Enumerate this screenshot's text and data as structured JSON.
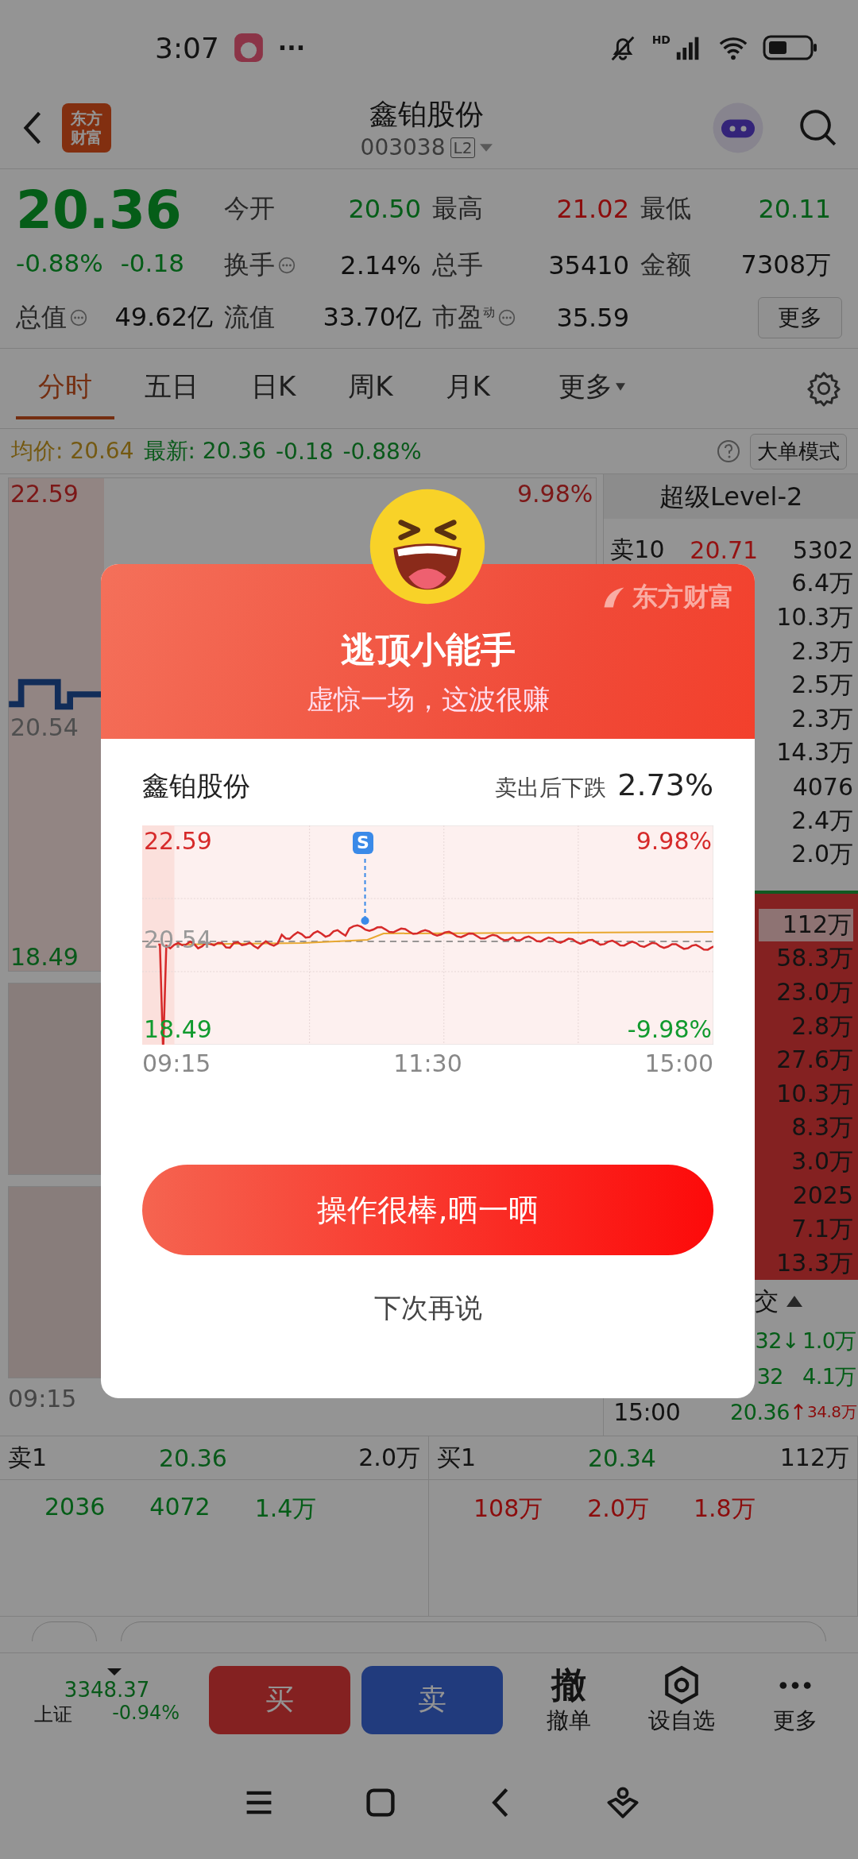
{
  "status_bar": {
    "time": "3:07",
    "more": "···",
    "network": "HD"
  },
  "header": {
    "logo": [
      "东方",
      "财富"
    ],
    "title": "鑫铂股份",
    "code": "003038",
    "badge": "L2"
  },
  "quote": {
    "price": "20.36",
    "change_pct": "-0.88%",
    "change": "-0.18",
    "kind": "down",
    "stats": [
      {
        "label": "今开",
        "value": "20.50",
        "kind": "down",
        "info": false
      },
      {
        "label": "最高",
        "value": "21.02",
        "kind": "up",
        "info": false
      },
      {
        "label": "最低",
        "value": "20.11",
        "kind": "down",
        "info": false
      },
      {
        "label": "换手",
        "value": "2.14%",
        "kind": "flat",
        "info": true
      },
      {
        "label": "总手",
        "value": "35410",
        "kind": "flat",
        "info": false
      },
      {
        "label": "金额",
        "value": "7308万",
        "kind": "flat",
        "info": false
      },
      {
        "label": "总值",
        "value": "49.62亿",
        "kind": "flat",
        "info": true
      },
      {
        "label": "流值",
        "value": "33.70亿",
        "kind": "flat",
        "info": false
      },
      {
        "label": "市盈",
        "sup": "动",
        "value": "35.59",
        "kind": "flat",
        "info": true
      }
    ],
    "more_button": "更多"
  },
  "tabs": [
    {
      "label": "分时",
      "selected": true,
      "kind": "tab"
    },
    {
      "label": "五日",
      "selected": false,
      "kind": "tab"
    },
    {
      "label": "日K",
      "selected": false,
      "kind": "tab"
    },
    {
      "label": "周K",
      "selected": false,
      "kind": "tab"
    },
    {
      "label": "月K",
      "selected": false,
      "kind": "tab"
    },
    {
      "label": "更多",
      "selected": false,
      "kind": "dropdown"
    }
  ],
  "info_line": {
    "avg_label": "均价:",
    "avg": "20.64",
    "latest_label": "最新:",
    "latest": "20.36",
    "change": "-0.18",
    "change_pct": "-0.88%",
    "mode_button": "大单模式"
  },
  "main_chart": {
    "top_price": "22.59",
    "top_pct": "9.98%",
    "mid_price": "20.54",
    "bottom_price": "18.49",
    "start_time": "09:15"
  },
  "order_book": {
    "title": "超级Level-2",
    "sell": [
      {
        "label": "卖10",
        "price": "20.71",
        "qty": "5302"
      },
      {
        "qty": "6.4万"
      },
      {
        "qty": "10.3万"
      },
      {
        "qty": "2.3万"
      },
      {
        "qty": "2.5万"
      },
      {
        "qty": "2.3万"
      },
      {
        "qty": "14.3万"
      },
      {
        "qty": "4076"
      },
      {
        "qty": "2.4万"
      },
      {
        "qty": "2.0万"
      }
    ],
    "buy": [
      {
        "qty": "112万",
        "highlighted": true
      },
      {
        "qty": "58.3万",
        "highlighted": false
      },
      {
        "qty": "23.0万",
        "highlighted": false
      },
      {
        "qty": "2.8万",
        "highlighted": false
      },
      {
        "qty": "27.6万",
        "highlighted": false
      },
      {
        "qty": "10.3万",
        "highlighted": false
      },
      {
        "qty": "8.3万",
        "highlighted": false
      },
      {
        "qty": "3.0万",
        "highlighted": false
      },
      {
        "qty": "2025",
        "highlighted": false
      },
      {
        "qty": "7.1万",
        "highlighted": false
      },
      {
        "qty": "13.3万",
        "highlighted": false
      }
    ],
    "trades_title": "交",
    "trades": [
      {
        "price": "32",
        "arrow": "↓",
        "volume": "1.0万",
        "kind": "down"
      },
      {
        "price": "32",
        "volume": "4.1万",
        "kind": "down"
      },
      {
        "time": "15:00",
        "price": "20.36",
        "arrow": "↑",
        "volume": "34.8万",
        "kind": "mixed"
      }
    ]
  },
  "level1": {
    "sell": {
      "label": "卖1",
      "price": "20.36",
      "qty": "2.0万",
      "details": [
        "2036",
        "4072",
        "1.4万"
      ]
    },
    "buy": {
      "label": "买1",
      "price": "20.34",
      "qty": "112万",
      "details": [
        "108万",
        "2.0万",
        "1.8万"
      ]
    }
  },
  "toolbar": {
    "index_value": "3348.37",
    "index_name": "上证",
    "index_change": "-0.94%",
    "buy": "买",
    "sell": "卖",
    "cancel_glyph": "撤",
    "cancel": "撤单",
    "watchlist": "设自选",
    "more": "更多"
  },
  "dialog": {
    "brand": "东方财富",
    "title": "逃顶小能手",
    "subtitle": "虚惊一场，这波很赚",
    "stock": "鑫铂股份",
    "result_label": "卖出后下跌",
    "result": "2.73%",
    "chart": {
      "top_price": "22.59",
      "top_pct": "9.98%",
      "mid_price": "20.54",
      "bottom_price": "18.49",
      "bottom_pct": "-9.98%",
      "marker": "S",
      "times": [
        "09:15",
        "11:30",
        "15:00"
      ]
    },
    "share_button": "操作很棒,晒一晒",
    "dismiss": "下次再说"
  }
}
